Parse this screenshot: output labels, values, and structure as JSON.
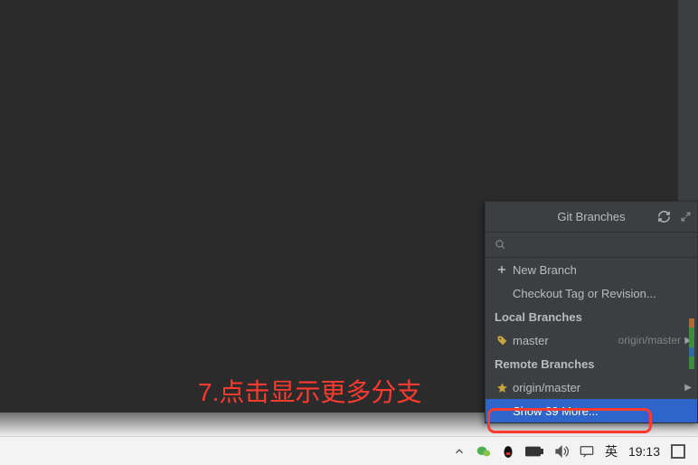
{
  "annotation": {
    "text": "7.点击显示更多分支"
  },
  "popup": {
    "title": "Git Branches",
    "search_placeholder": "",
    "actions": {
      "new_branch": "New Branch",
      "checkout_tag": "Checkout Tag or Revision..."
    },
    "sections": {
      "local_label": "Local Branches",
      "remote_label": "Remote Branches"
    },
    "local": [
      {
        "name": "master",
        "tracking": "origin/master"
      }
    ],
    "remote": [
      {
        "name": "origin/master"
      }
    ],
    "show_more": "Show 39 More..."
  },
  "taskbar": {
    "ime": "英",
    "clock": "19:13"
  },
  "colors": {
    "selection": "#2f65ca",
    "panel_bg": "#3c3f41",
    "editor_bg": "#2b2b2b",
    "annotation_red": "#ff3a2f"
  }
}
